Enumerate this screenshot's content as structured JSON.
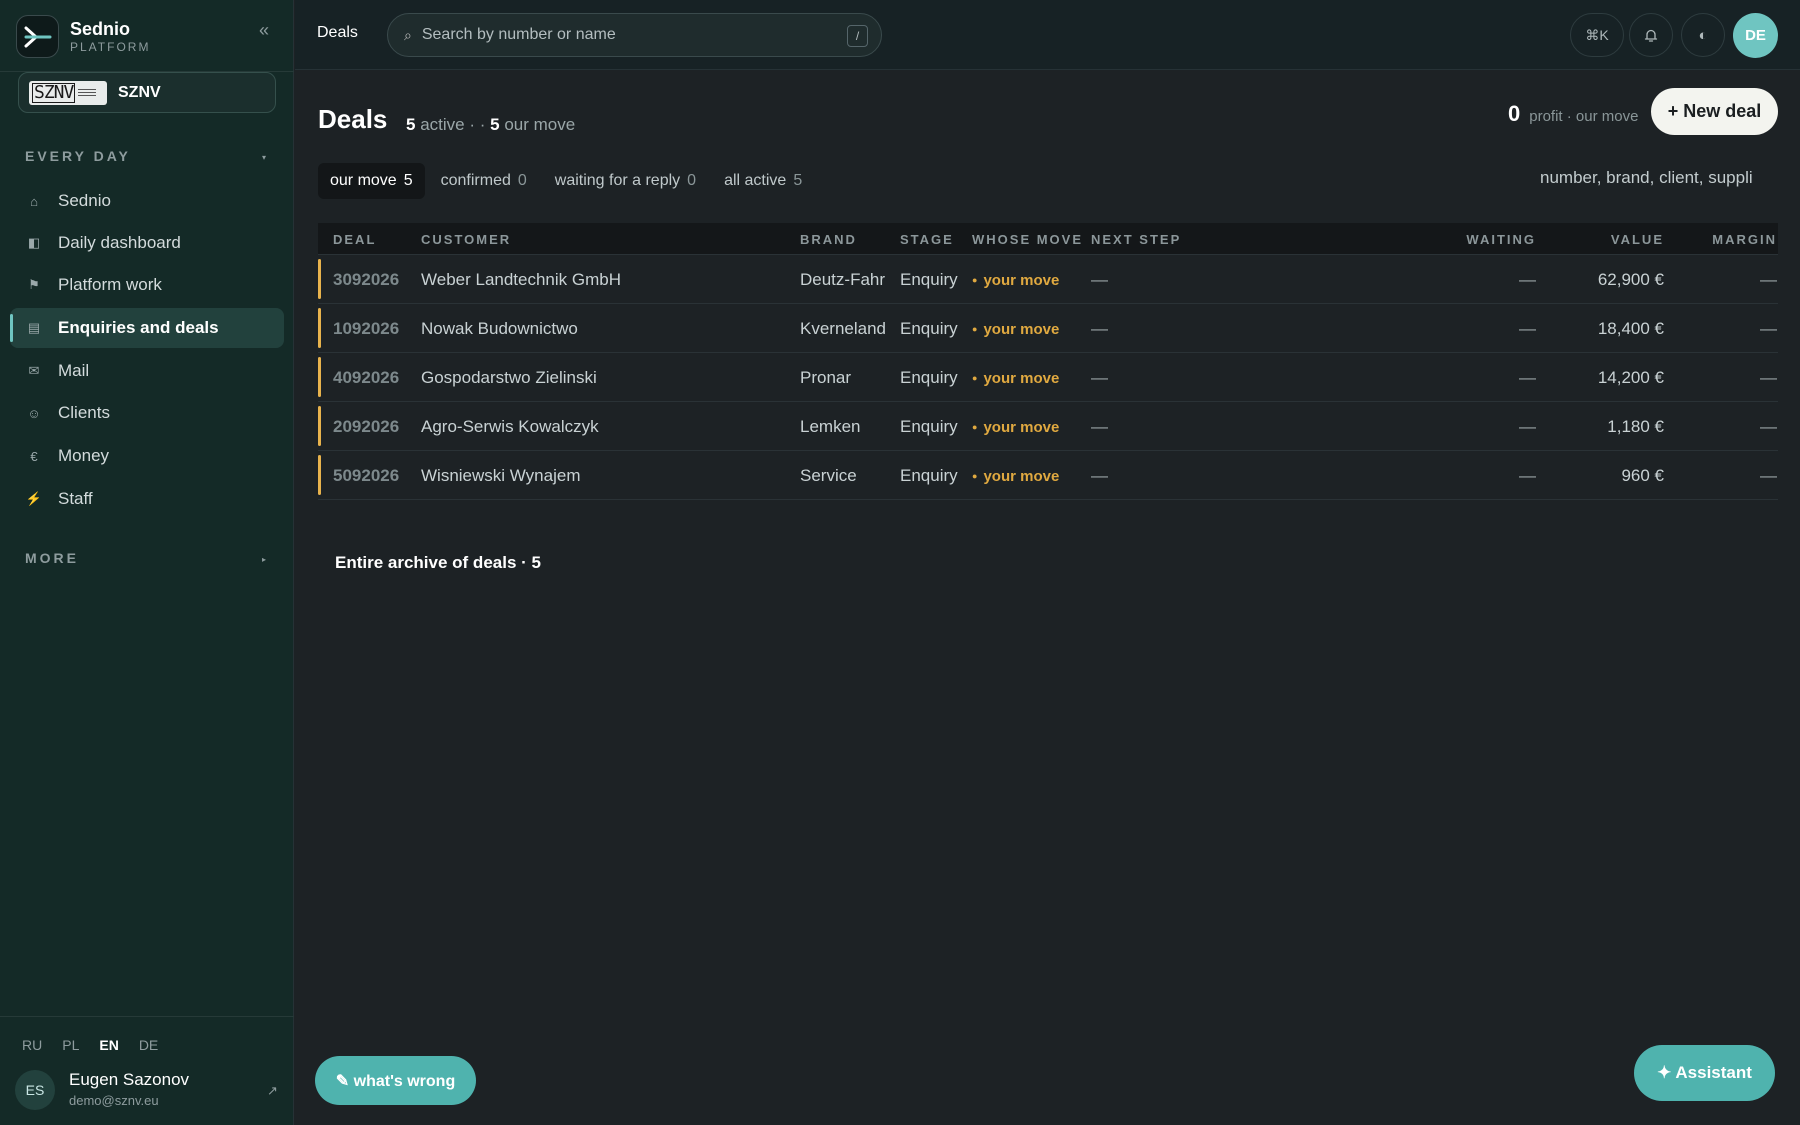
{
  "app": {
    "name": "Sednio",
    "subtitle": "PLATFORM",
    "collapse_icon": "«",
    "org_logo_text": "SZNV",
    "org_name": "SZNV"
  },
  "sidebar": {
    "section_everyday": "EVERY DAY",
    "section_more": "MORE",
    "items": [
      {
        "label": "Sednio",
        "icon": "home-icon",
        "glyph": "⌂"
      },
      {
        "label": "Daily dashboard",
        "icon": "dashboard-icon",
        "glyph": "◧"
      },
      {
        "label": "Platform work",
        "icon": "flag-icon",
        "glyph": "⚑"
      },
      {
        "label": "Enquiries and deals",
        "icon": "list-icon",
        "glyph": "▤",
        "active": true
      },
      {
        "label": "Mail",
        "icon": "mail-icon",
        "glyph": "✉"
      },
      {
        "label": "Clients",
        "icon": "smiley-icon",
        "glyph": "☺"
      },
      {
        "label": "Money",
        "icon": "euro-icon",
        "glyph": "€"
      },
      {
        "label": "Staff",
        "icon": "lightning-icon",
        "glyph": "⚡"
      }
    ],
    "languages": [
      "RU",
      "PL",
      "EN",
      "DE"
    ],
    "active_language": "EN",
    "user": {
      "initials": "ES",
      "name": "Eugen Sazonov",
      "email": "demo@sznv.eu",
      "link_glyph": "↗"
    }
  },
  "topbar": {
    "breadcrumb": "Deals",
    "search_placeholder": "Search by number or name",
    "search_shortcut": "/",
    "command_shortcut": "⌘K",
    "avatar_initials": "DE"
  },
  "main": {
    "title": "Deals",
    "active_count": "5",
    "active_label": "active ·",
    "separator": "·",
    "our_move_count": "5",
    "our_move_label": "our move",
    "profit_value": "0",
    "profit_label": "profit · our move",
    "new_deal_label": "+ New deal",
    "filters": [
      {
        "label": "our move",
        "count": "5",
        "active": true
      },
      {
        "label": "confirmed",
        "count": "0"
      },
      {
        "label": "waiting for a reply",
        "count": "0"
      },
      {
        "label": "all active",
        "count": "5"
      }
    ],
    "filter_search_placeholder": "number, brand, client, suppli",
    "columns": [
      "DEAL",
      "CUSTOMER",
      "BRAND",
      "STAGE",
      "WHOSE MOVE",
      "NEXT STEP",
      "WAITING",
      "VALUE",
      "MARGIN"
    ],
    "rows": [
      {
        "deal": "3092026",
        "customer": "Weber Landtechnik GmbH",
        "brand": "Deutz-Fahr",
        "stage": "Enquiry",
        "whose_move": "your move",
        "next_step": "—",
        "waiting": "—",
        "value": "62,900 €",
        "margin": "—"
      },
      {
        "deal": "1092026",
        "customer": "Nowak Budownictwo",
        "brand": "Kverneland",
        "stage": "Enquiry",
        "whose_move": "your move",
        "next_step": "—",
        "waiting": "—",
        "value": "18,400 €",
        "margin": "—"
      },
      {
        "deal": "4092026",
        "customer": "Gospodarstwo Zielinski",
        "brand": "Pronar",
        "stage": "Enquiry",
        "whose_move": "your move",
        "next_step": "—",
        "waiting": "—",
        "value": "14,200 €",
        "margin": "—"
      },
      {
        "deal": "2092026",
        "customer": "Agro-Serwis Kowalczyk",
        "brand": "Lemken",
        "stage": "Enquiry",
        "whose_move": "your move",
        "next_step": "—",
        "waiting": "—",
        "value": "1,180 €",
        "margin": "—"
      },
      {
        "deal": "5092026",
        "customer": "Wisniewski Wynajem",
        "brand": "Service",
        "stage": "Enquiry",
        "whose_move": "your move",
        "next_step": "—",
        "waiting": "—",
        "value": "960 €",
        "margin": "—"
      }
    ],
    "archive_label": "Entire archive of deals · 5"
  },
  "floating": {
    "whats_wrong": "✎ what's wrong",
    "assistant": "✦ Assistant"
  },
  "colors": {
    "accent": "#6fc5c1",
    "button_teal": "#4fb3ae",
    "your_move": "#e0a940",
    "sidebar_bg": "#142a27",
    "main_bg": "#1d2225"
  }
}
